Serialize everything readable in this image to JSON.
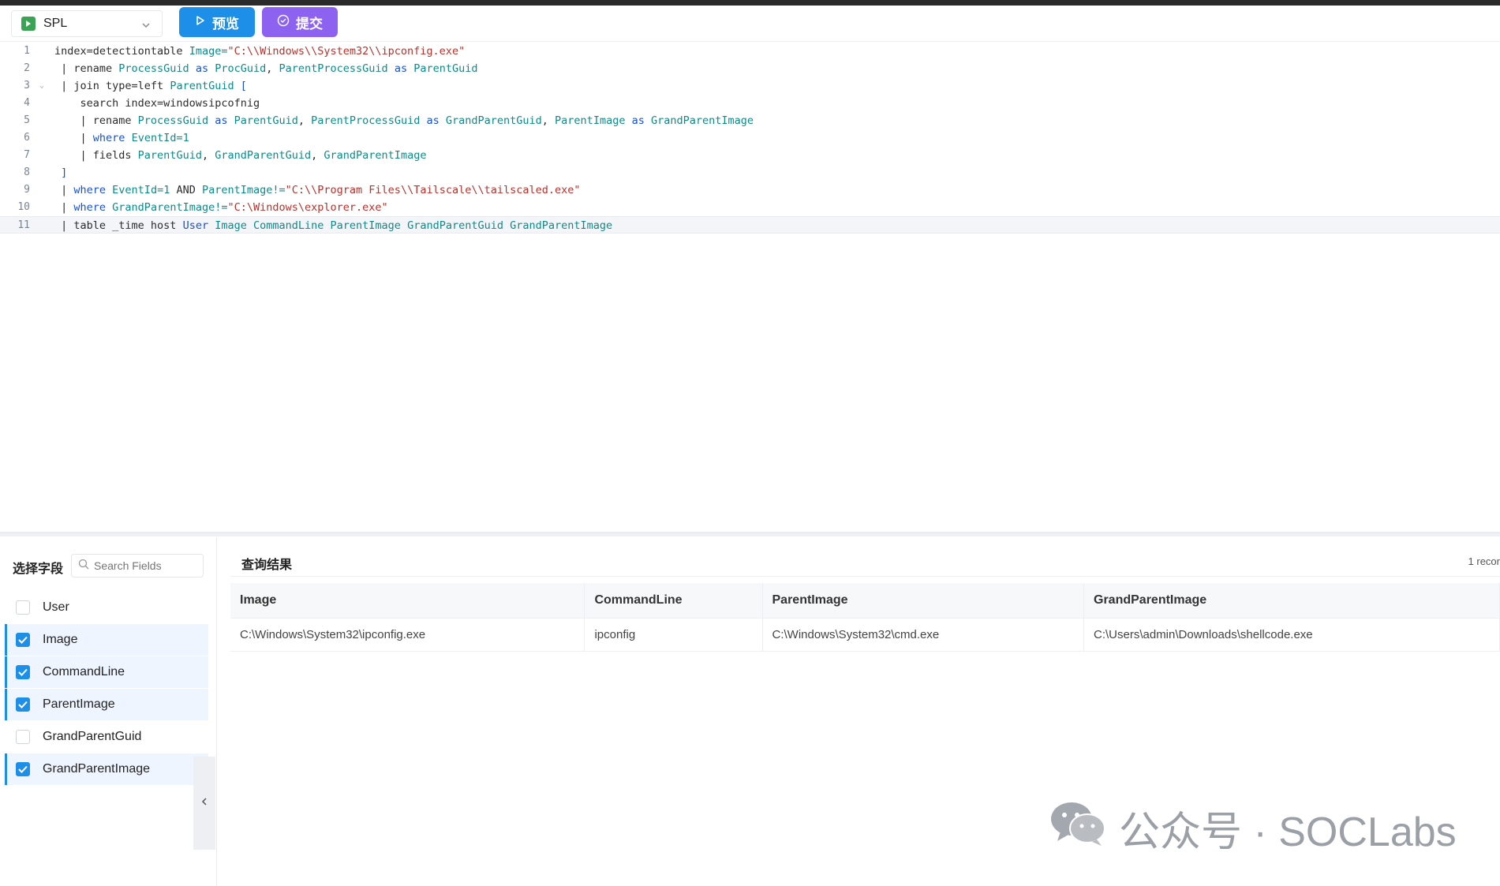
{
  "toolbar": {
    "language": "SPL",
    "preview_label": "预览",
    "submit_label": "提交"
  },
  "editor": {
    "lines": [
      {
        "num": "1",
        "segments": [
          [
            "",
            "index=detectiontable "
          ],
          [
            "id",
            "Image="
          ],
          [
            "str",
            "\"C:\\\\Windows\\\\System32\\\\ipconfig.exe\""
          ]
        ]
      },
      {
        "num": "2",
        "segments": [
          [
            "",
            " | rename "
          ],
          [
            "id",
            "ProcessGuid "
          ],
          [
            "kw",
            "as "
          ],
          [
            "id",
            "ProcGuid"
          ],
          [
            "",
            ", "
          ],
          [
            "id",
            "ParentProcessGuid "
          ],
          [
            "kw",
            "as "
          ],
          [
            "id",
            "ParentGuid"
          ]
        ]
      },
      {
        "num": "3",
        "segments": [
          [
            "",
            " | join type=left "
          ],
          [
            "id",
            "ParentGuid "
          ],
          [
            "kw",
            "["
          ]
        ]
      },
      {
        "num": "4",
        "segments": [
          [
            "",
            "    search index=windowsipcofnig"
          ]
        ]
      },
      {
        "num": "5",
        "segments": [
          [
            "",
            "    | rename "
          ],
          [
            "id",
            "ProcessGuid "
          ],
          [
            "kw",
            "as "
          ],
          [
            "id",
            "ParentGuid"
          ],
          [
            "",
            ", "
          ],
          [
            "id",
            "ParentProcessGuid "
          ],
          [
            "kw",
            "as "
          ],
          [
            "id",
            "GrandParentGuid"
          ],
          [
            "",
            ", "
          ],
          [
            "id",
            "ParentImage "
          ],
          [
            "kw",
            "as "
          ],
          [
            "id",
            "GrandParentImage"
          ]
        ]
      },
      {
        "num": "6",
        "segments": [
          [
            "",
            "    | "
          ],
          [
            "kw",
            "where "
          ],
          [
            "id",
            "EventId=1"
          ]
        ]
      },
      {
        "num": "7",
        "segments": [
          [
            "",
            "    | fields "
          ],
          [
            "id",
            "ParentGuid"
          ],
          [
            "",
            ", "
          ],
          [
            "id",
            "GrandParentGuid"
          ],
          [
            "",
            ", "
          ],
          [
            "id",
            "GrandParentImage"
          ]
        ]
      },
      {
        "num": "8",
        "segments": [
          [
            "kw",
            " ]"
          ]
        ]
      },
      {
        "num": "9",
        "segments": [
          [
            "",
            " | "
          ],
          [
            "kw",
            "where "
          ],
          [
            "id",
            "EventId=1 "
          ],
          [
            "",
            "AND "
          ],
          [
            "id",
            "ParentImage!="
          ],
          [
            "str",
            "\"C:\\\\Program Files\\\\Tailscale\\\\tailscaled.exe\""
          ]
        ]
      },
      {
        "num": "10",
        "segments": [
          [
            "",
            " | "
          ],
          [
            "kw",
            "where "
          ],
          [
            "id",
            "GrandParentImage!="
          ],
          [
            "str",
            "\"C:\\Windows\\explorer.exe\""
          ]
        ]
      },
      {
        "num": "11",
        "segments": [
          [
            "",
            " | table _time host "
          ],
          [
            "kw",
            "User "
          ],
          [
            "id",
            "Image "
          ],
          [
            "id",
            "CommandLine "
          ],
          [
            "id",
            "ParentImage "
          ],
          [
            "id",
            "GrandParentGuid "
          ],
          [
            "id",
            "GrandParentImage"
          ]
        ]
      }
    ]
  },
  "fields_panel": {
    "title": "选择字段",
    "search_placeholder": "Search Fields",
    "items": [
      {
        "label": "User",
        "checked": false
      },
      {
        "label": "Image",
        "checked": true
      },
      {
        "label": "CommandLine",
        "checked": true
      },
      {
        "label": "ParentImage",
        "checked": true
      },
      {
        "label": "GrandParentGuid",
        "checked": false
      },
      {
        "label": "GrandParentImage",
        "checked": true
      }
    ]
  },
  "results": {
    "title": "查询结果",
    "count": "1 recor",
    "columns": [
      "Image",
      "CommandLine",
      "ParentImage",
      "GrandParentImage"
    ],
    "rows": [
      [
        "C:\\Windows\\System32\\ipconfig.exe",
        "ipconfig",
        "C:\\Windows\\System32\\cmd.exe",
        "C:\\Users\\admin\\Downloads\\shellcode.exe"
      ]
    ]
  },
  "watermark": {
    "text": "公众号 · SOCLabs"
  },
  "colors": {
    "primary": "#1d8fe9",
    "submit": "#8e62f0",
    "keyword": "#1a4fd6",
    "identifier": "#0f8a8a",
    "string": "#b8322c"
  }
}
